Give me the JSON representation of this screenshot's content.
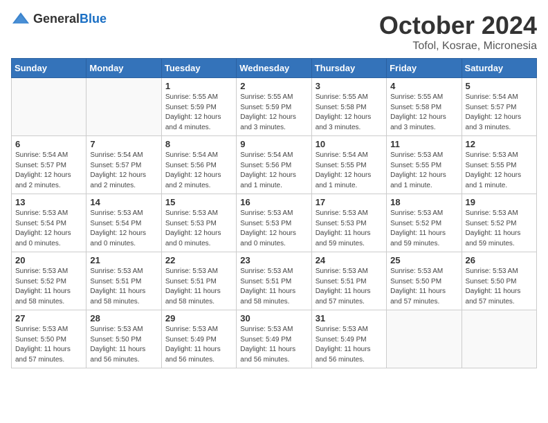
{
  "header": {
    "logo_general": "General",
    "logo_blue": "Blue",
    "month": "October 2024",
    "location": "Tofol, Kosrae, Micronesia"
  },
  "weekdays": [
    "Sunday",
    "Monday",
    "Tuesday",
    "Wednesday",
    "Thursday",
    "Friday",
    "Saturday"
  ],
  "weeks": [
    [
      {
        "day": "",
        "info": ""
      },
      {
        "day": "",
        "info": ""
      },
      {
        "day": "1",
        "info": "Sunrise: 5:55 AM\nSunset: 5:59 PM\nDaylight: 12 hours\nand 4 minutes."
      },
      {
        "day": "2",
        "info": "Sunrise: 5:55 AM\nSunset: 5:59 PM\nDaylight: 12 hours\nand 3 minutes."
      },
      {
        "day": "3",
        "info": "Sunrise: 5:55 AM\nSunset: 5:58 PM\nDaylight: 12 hours\nand 3 minutes."
      },
      {
        "day": "4",
        "info": "Sunrise: 5:55 AM\nSunset: 5:58 PM\nDaylight: 12 hours\nand 3 minutes."
      },
      {
        "day": "5",
        "info": "Sunrise: 5:54 AM\nSunset: 5:57 PM\nDaylight: 12 hours\nand 3 minutes."
      }
    ],
    [
      {
        "day": "6",
        "info": "Sunrise: 5:54 AM\nSunset: 5:57 PM\nDaylight: 12 hours\nand 2 minutes."
      },
      {
        "day": "7",
        "info": "Sunrise: 5:54 AM\nSunset: 5:57 PM\nDaylight: 12 hours\nand 2 minutes."
      },
      {
        "day": "8",
        "info": "Sunrise: 5:54 AM\nSunset: 5:56 PM\nDaylight: 12 hours\nand 2 minutes."
      },
      {
        "day": "9",
        "info": "Sunrise: 5:54 AM\nSunset: 5:56 PM\nDaylight: 12 hours\nand 1 minute."
      },
      {
        "day": "10",
        "info": "Sunrise: 5:54 AM\nSunset: 5:55 PM\nDaylight: 12 hours\nand 1 minute."
      },
      {
        "day": "11",
        "info": "Sunrise: 5:53 AM\nSunset: 5:55 PM\nDaylight: 12 hours\nand 1 minute."
      },
      {
        "day": "12",
        "info": "Sunrise: 5:53 AM\nSunset: 5:55 PM\nDaylight: 12 hours\nand 1 minute."
      }
    ],
    [
      {
        "day": "13",
        "info": "Sunrise: 5:53 AM\nSunset: 5:54 PM\nDaylight: 12 hours\nand 0 minutes."
      },
      {
        "day": "14",
        "info": "Sunrise: 5:53 AM\nSunset: 5:54 PM\nDaylight: 12 hours\nand 0 minutes."
      },
      {
        "day": "15",
        "info": "Sunrise: 5:53 AM\nSunset: 5:53 PM\nDaylight: 12 hours\nand 0 minutes."
      },
      {
        "day": "16",
        "info": "Sunrise: 5:53 AM\nSunset: 5:53 PM\nDaylight: 12 hours\nand 0 minutes."
      },
      {
        "day": "17",
        "info": "Sunrise: 5:53 AM\nSunset: 5:53 PM\nDaylight: 11 hours\nand 59 minutes."
      },
      {
        "day": "18",
        "info": "Sunrise: 5:53 AM\nSunset: 5:52 PM\nDaylight: 11 hours\nand 59 minutes."
      },
      {
        "day": "19",
        "info": "Sunrise: 5:53 AM\nSunset: 5:52 PM\nDaylight: 11 hours\nand 59 minutes."
      }
    ],
    [
      {
        "day": "20",
        "info": "Sunrise: 5:53 AM\nSunset: 5:52 PM\nDaylight: 11 hours\nand 58 minutes."
      },
      {
        "day": "21",
        "info": "Sunrise: 5:53 AM\nSunset: 5:51 PM\nDaylight: 11 hours\nand 58 minutes."
      },
      {
        "day": "22",
        "info": "Sunrise: 5:53 AM\nSunset: 5:51 PM\nDaylight: 11 hours\nand 58 minutes."
      },
      {
        "day": "23",
        "info": "Sunrise: 5:53 AM\nSunset: 5:51 PM\nDaylight: 11 hours\nand 58 minutes."
      },
      {
        "day": "24",
        "info": "Sunrise: 5:53 AM\nSunset: 5:51 PM\nDaylight: 11 hours\nand 57 minutes."
      },
      {
        "day": "25",
        "info": "Sunrise: 5:53 AM\nSunset: 5:50 PM\nDaylight: 11 hours\nand 57 minutes."
      },
      {
        "day": "26",
        "info": "Sunrise: 5:53 AM\nSunset: 5:50 PM\nDaylight: 11 hours\nand 57 minutes."
      }
    ],
    [
      {
        "day": "27",
        "info": "Sunrise: 5:53 AM\nSunset: 5:50 PM\nDaylight: 11 hours\nand 57 minutes."
      },
      {
        "day": "28",
        "info": "Sunrise: 5:53 AM\nSunset: 5:50 PM\nDaylight: 11 hours\nand 56 minutes."
      },
      {
        "day": "29",
        "info": "Sunrise: 5:53 AM\nSunset: 5:49 PM\nDaylight: 11 hours\nand 56 minutes."
      },
      {
        "day": "30",
        "info": "Sunrise: 5:53 AM\nSunset: 5:49 PM\nDaylight: 11 hours\nand 56 minutes."
      },
      {
        "day": "31",
        "info": "Sunrise: 5:53 AM\nSunset: 5:49 PM\nDaylight: 11 hours\nand 56 minutes."
      },
      {
        "day": "",
        "info": ""
      },
      {
        "day": "",
        "info": ""
      }
    ]
  ]
}
